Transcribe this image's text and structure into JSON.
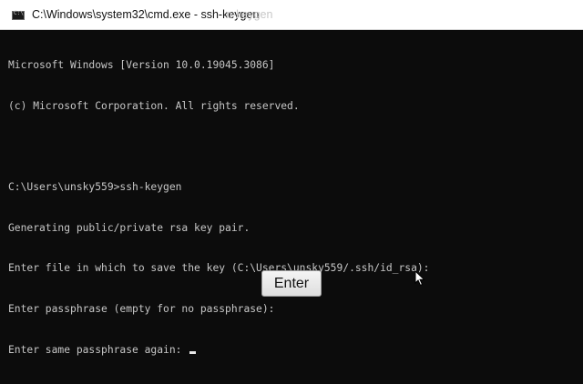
{
  "window": {
    "title": "C:\\Windows\\system32\\cmd.exe - ssh-keygen",
    "title_ghost": "n-keygen"
  },
  "console": {
    "lines": [
      "Microsoft Windows [Version 10.0.19045.3086]",
      "(c) Microsoft Corporation. All rights reserved.",
      "",
      "C:\\Users\\unsky559>ssh-keygen",
      "Generating public/private rsa key pair.",
      "Enter file in which to save the key (C:\\Users\\unsky559/.ssh/id_rsa):",
      "Enter passphrase (empty for no passphrase):",
      "Enter same passphrase again: "
    ]
  },
  "overlay": {
    "enter_label": "Enter"
  },
  "colors": {
    "console_bg": "#0c0c0c",
    "console_text": "#c7c7c7",
    "titlebar_bg": "#ffffff"
  },
  "icons": {
    "app": "cmd-icon",
    "pointer": "mouse-pointer-icon"
  }
}
